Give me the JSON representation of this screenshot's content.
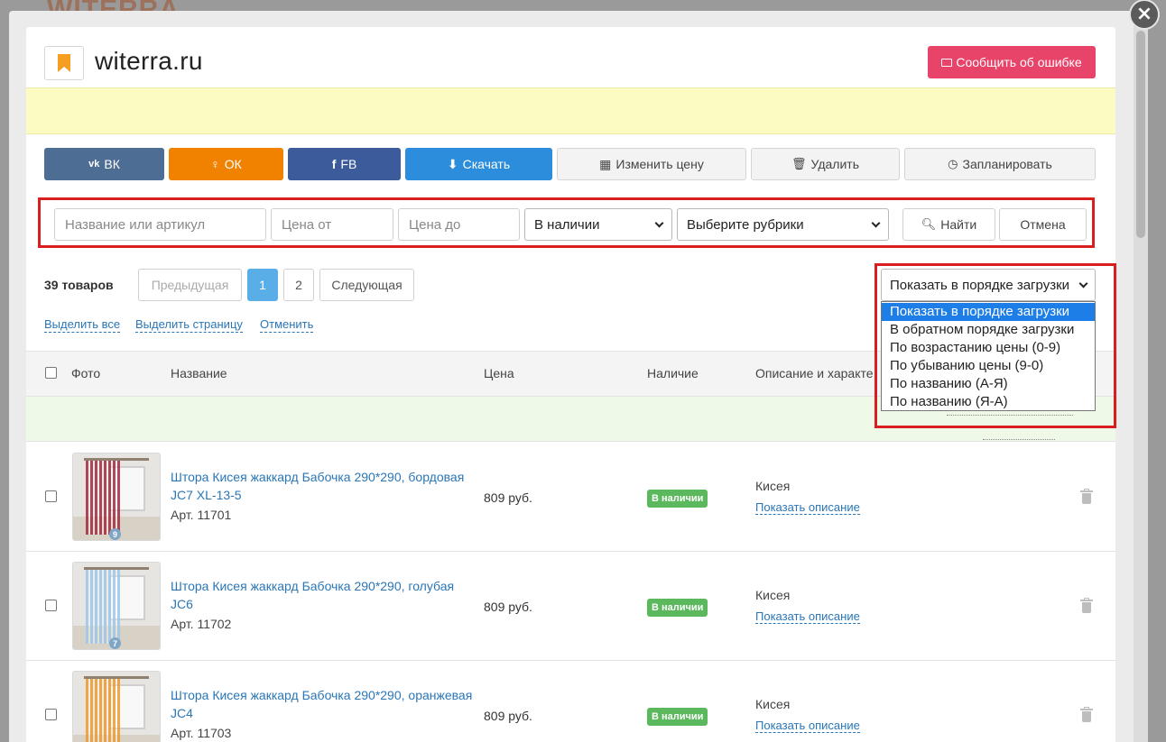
{
  "background": {
    "logo_text": "WITERRA"
  },
  "modal": {
    "close_label": "×"
  },
  "header": {
    "site_name": "witerra.ru",
    "report_button": "Сообщить об ошибке"
  },
  "actions": [
    {
      "label": "ВК",
      "icon": "vk-icon",
      "color": "#4e6d95"
    },
    {
      "label": "ОК",
      "icon": "ok-icon",
      "color": "#f08200"
    },
    {
      "label": "FB",
      "icon": "facebook-icon",
      "color": "#3b5b9b"
    },
    {
      "label": "Скачать",
      "icon": "download-icon",
      "color": "#2b8ddb"
    },
    {
      "label": "Изменить цену",
      "icon": "calculator-icon"
    },
    {
      "label": "Удалить",
      "icon": "trash-icon"
    },
    {
      "label": "Запланировать",
      "icon": "clock-icon"
    }
  ],
  "filters": {
    "name_placeholder": "Название или артикул",
    "price_from_placeholder": "Цена от",
    "price_to_placeholder": "Цена до",
    "availability": "В наличии",
    "category": "Выберите рубрики",
    "search_button": "Найти",
    "cancel_button": "Отмена"
  },
  "pagination": {
    "count_label": "39 товаров",
    "prev": "Предыдущая",
    "pages": [
      "1",
      "2"
    ],
    "current": "1",
    "next": "Следующая"
  },
  "selection_links": [
    "Выделить все",
    "Выделить страницу",
    "Отменить"
  ],
  "sort": {
    "selected": "Показать в порядке загрузки",
    "options": [
      "Показать в порядке загрузки",
      "В обратном порядке загрузки",
      "По возрастанию цены (0-9)",
      "По убыванию цены (9-0)",
      "По названию (А-Я)",
      "По названию (Я-А)"
    ]
  },
  "table": {
    "columns": [
      "Фото",
      "Название",
      "Цена",
      "Наличие",
      "Описание и характе"
    ],
    "rows": [
      {
        "name": "Штора Кисея жаккард Бабочка 290*290, бордовая JC7 XL-13-5",
        "article": "Арт. 11701",
        "price": "809 руб.",
        "status": "В наличии",
        "description": "Кисея",
        "show_description": "Показать описание",
        "photo_count": "9",
        "curtain_color": "#a32a3f"
      },
      {
        "name": "Штора Кисея жаккард Бабочка 290*290, голубая JC6",
        "article": "Арт. 11702",
        "price": "809 руб.",
        "status": "В наличии",
        "description": "Кисея",
        "show_description": "Показать описание",
        "photo_count": "7",
        "curtain_color": "#9cc7ea"
      },
      {
        "name": "Штора Кисея жаккард Бабочка 290*290, оранжевая JC4",
        "article": "Арт. 11703",
        "price": "809 руб.",
        "status": "В наличии",
        "description": "Кисея",
        "show_description": "Показать описание",
        "photo_count": "",
        "curtain_color": "#ee9a2a"
      }
    ]
  }
}
